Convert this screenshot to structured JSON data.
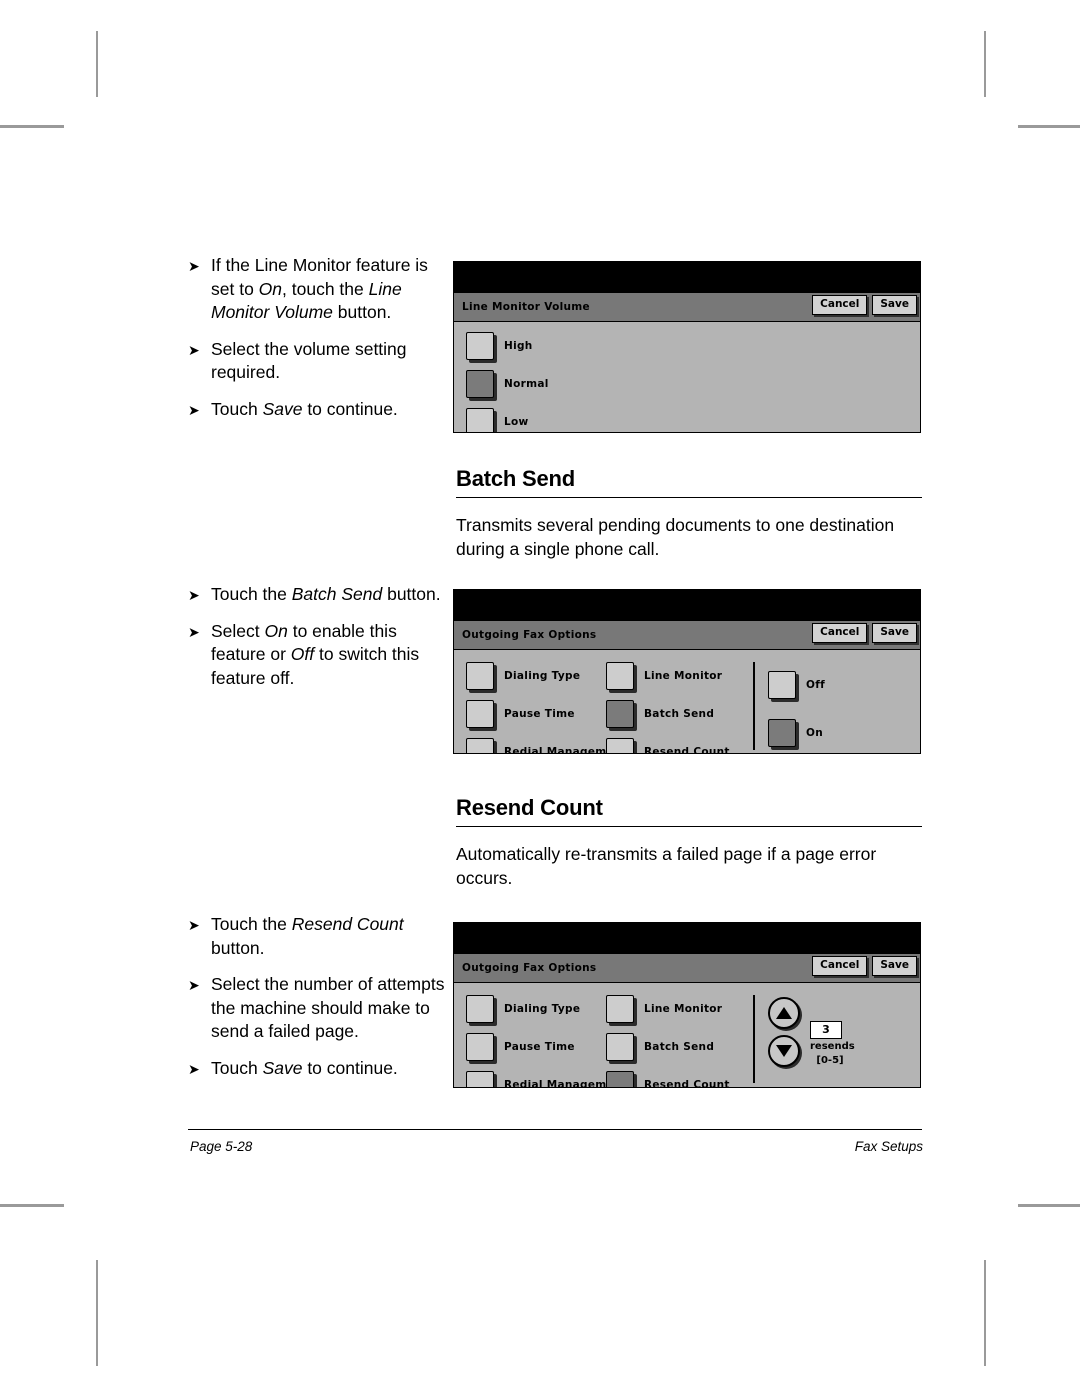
{
  "document": {
    "footer": {
      "page_label": "Page 5-28",
      "section_label": "Fax Setups"
    }
  },
  "line_monitor_steps": {
    "items": [
      {
        "marker": "➤",
        "html": "If the Line Monitor feature is set to <i>On</i>, touch the <i>Line Monitor Volume</i> button."
      },
      {
        "marker": "➤",
        "html": "Select the volume setting required."
      },
      {
        "marker": "➤",
        "html": "Touch <i>Save</i> to continue."
      }
    ]
  },
  "batch_send_steps": {
    "items": [
      {
        "marker": "➤",
        "html": "Touch the <i>Batch Send</i> button."
      },
      {
        "marker": "➤",
        "html": "Select <i>On</i> to enable this feature or <i>Off</i> to switch this feature off."
      }
    ]
  },
  "resend_count_steps": {
    "items": [
      {
        "marker": "➤",
        "html": "Touch the <i>Resend Count</i> button."
      },
      {
        "marker": "➤",
        "html": "Select the number of attempts the machine should make to send a failed page."
      },
      {
        "marker": "➤",
        "html": "Touch <i>Save</i> to continue."
      }
    ]
  },
  "sections": {
    "batch_send": {
      "title": "Batch Send",
      "body": "Transmits several pending documents to one destination during a single phone call."
    },
    "resend_count": {
      "title": "Resend Count",
      "body": "Automatically re-transmits a failed page if a page error occurs."
    }
  },
  "panel_line_monitor_volume": {
    "title": "Line Monitor Volume",
    "cancel_label": "Cancel",
    "save_label": "Save",
    "options": [
      {
        "label": "High",
        "selected": false
      },
      {
        "label": "Normal",
        "selected": true
      },
      {
        "label": "Low",
        "selected": false
      }
    ]
  },
  "panel_batch_send": {
    "title": "Outgoing Fax Options",
    "cancel_label": "Cancel",
    "save_label": "Save",
    "column_left": [
      {
        "label": "Dialing Type",
        "selected": false
      },
      {
        "label": "Pause Time",
        "selected": false
      },
      {
        "label": "Redial Management",
        "selected": false
      }
    ],
    "column_middle": [
      {
        "label": "Line Monitor",
        "selected": false
      },
      {
        "label": "Batch Send",
        "selected": true
      },
      {
        "label": "Resend Count",
        "selected": false
      }
    ],
    "column_right": [
      {
        "label": "Off",
        "selected": false
      },
      {
        "label": "On",
        "selected": true
      }
    ]
  },
  "panel_resend_count": {
    "title": "Outgoing Fax Options",
    "cancel_label": "Cancel",
    "save_label": "Save",
    "column_left": [
      {
        "label": "Dialing Type",
        "selected": false
      },
      {
        "label": "Pause Time",
        "selected": false
      },
      {
        "label": "Redial Management",
        "selected": false
      }
    ],
    "column_middle": [
      {
        "label": "Line Monitor",
        "selected": false
      },
      {
        "label": "Batch Send",
        "selected": false
      },
      {
        "label": "Resend Count",
        "selected": true
      }
    ],
    "stepper": {
      "value": "3",
      "unit_label": "resends",
      "range_label": "[0-5]"
    }
  },
  "colors": {
    "panel_background": "#b4b4b4",
    "panel_titlebar": "#787878",
    "panel_topbar": "#000000",
    "button_face": "#cdcdcd",
    "button_selected": "#7b7b7b"
  }
}
